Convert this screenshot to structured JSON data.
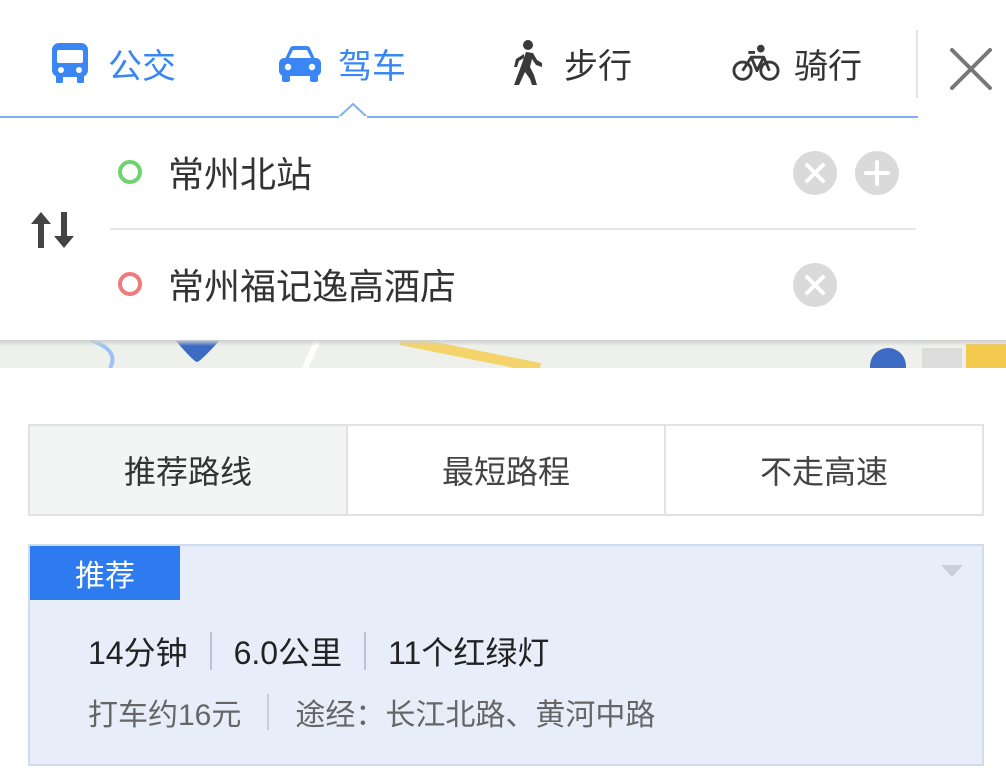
{
  "modes": [
    {
      "label": "公交",
      "icon": "bus-icon"
    },
    {
      "label": "驾车",
      "icon": "car-icon"
    },
    {
      "label": "步行",
      "icon": "walk-icon"
    },
    {
      "label": "骑行",
      "icon": "bike-icon"
    }
  ],
  "active_mode": "驾车",
  "route": {
    "start": "常州北站",
    "end": "常州福记逸高酒店"
  },
  "strategies": [
    "推荐路线",
    "最短路程",
    "不走高速"
  ],
  "selected_strategy": "推荐路线",
  "result": {
    "badge": "推荐",
    "duration": "14分钟",
    "distance": "6.0公里",
    "lights": "11个红绿灯",
    "taxi": "打车约16元",
    "via": "途经：长江北路、黄河中路"
  },
  "colors": {
    "accent": "#3a86f5",
    "badge": "#2e7bf0",
    "card_bg": "#e7eefa",
    "start_dot": "#6fd36f",
    "end_dot": "#f07a7a"
  }
}
